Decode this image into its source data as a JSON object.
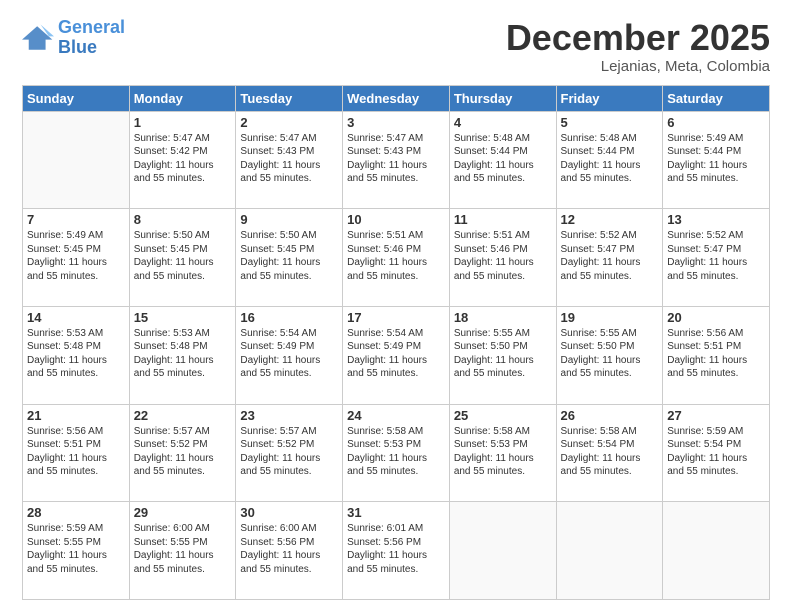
{
  "logo": {
    "line1": "General",
    "line2": "Blue"
  },
  "header": {
    "month": "December 2025",
    "location": "Lejanias, Meta, Colombia"
  },
  "days_of_week": [
    "Sunday",
    "Monday",
    "Tuesday",
    "Wednesday",
    "Thursday",
    "Friday",
    "Saturday"
  ],
  "weeks": [
    [
      {
        "day": "",
        "info": ""
      },
      {
        "day": "1",
        "info": "Sunrise: 5:47 AM\nSunset: 5:42 PM\nDaylight: 11 hours\nand 55 minutes."
      },
      {
        "day": "2",
        "info": "Sunrise: 5:47 AM\nSunset: 5:43 PM\nDaylight: 11 hours\nand 55 minutes."
      },
      {
        "day": "3",
        "info": "Sunrise: 5:47 AM\nSunset: 5:43 PM\nDaylight: 11 hours\nand 55 minutes."
      },
      {
        "day": "4",
        "info": "Sunrise: 5:48 AM\nSunset: 5:44 PM\nDaylight: 11 hours\nand 55 minutes."
      },
      {
        "day": "5",
        "info": "Sunrise: 5:48 AM\nSunset: 5:44 PM\nDaylight: 11 hours\nand 55 minutes."
      },
      {
        "day": "6",
        "info": "Sunrise: 5:49 AM\nSunset: 5:44 PM\nDaylight: 11 hours\nand 55 minutes."
      }
    ],
    [
      {
        "day": "7",
        "info": "Sunrise: 5:49 AM\nSunset: 5:45 PM\nDaylight: 11 hours\nand 55 minutes."
      },
      {
        "day": "8",
        "info": "Sunrise: 5:50 AM\nSunset: 5:45 PM\nDaylight: 11 hours\nand 55 minutes."
      },
      {
        "day": "9",
        "info": "Sunrise: 5:50 AM\nSunset: 5:45 PM\nDaylight: 11 hours\nand 55 minutes."
      },
      {
        "day": "10",
        "info": "Sunrise: 5:51 AM\nSunset: 5:46 PM\nDaylight: 11 hours\nand 55 minutes."
      },
      {
        "day": "11",
        "info": "Sunrise: 5:51 AM\nSunset: 5:46 PM\nDaylight: 11 hours\nand 55 minutes."
      },
      {
        "day": "12",
        "info": "Sunrise: 5:52 AM\nSunset: 5:47 PM\nDaylight: 11 hours\nand 55 minutes."
      },
      {
        "day": "13",
        "info": "Sunrise: 5:52 AM\nSunset: 5:47 PM\nDaylight: 11 hours\nand 55 minutes."
      }
    ],
    [
      {
        "day": "14",
        "info": "Sunrise: 5:53 AM\nSunset: 5:48 PM\nDaylight: 11 hours\nand 55 minutes."
      },
      {
        "day": "15",
        "info": "Sunrise: 5:53 AM\nSunset: 5:48 PM\nDaylight: 11 hours\nand 55 minutes."
      },
      {
        "day": "16",
        "info": "Sunrise: 5:54 AM\nSunset: 5:49 PM\nDaylight: 11 hours\nand 55 minutes."
      },
      {
        "day": "17",
        "info": "Sunrise: 5:54 AM\nSunset: 5:49 PM\nDaylight: 11 hours\nand 55 minutes."
      },
      {
        "day": "18",
        "info": "Sunrise: 5:55 AM\nSunset: 5:50 PM\nDaylight: 11 hours\nand 55 minutes."
      },
      {
        "day": "19",
        "info": "Sunrise: 5:55 AM\nSunset: 5:50 PM\nDaylight: 11 hours\nand 55 minutes."
      },
      {
        "day": "20",
        "info": "Sunrise: 5:56 AM\nSunset: 5:51 PM\nDaylight: 11 hours\nand 55 minutes."
      }
    ],
    [
      {
        "day": "21",
        "info": "Sunrise: 5:56 AM\nSunset: 5:51 PM\nDaylight: 11 hours\nand 55 minutes."
      },
      {
        "day": "22",
        "info": "Sunrise: 5:57 AM\nSunset: 5:52 PM\nDaylight: 11 hours\nand 55 minutes."
      },
      {
        "day": "23",
        "info": "Sunrise: 5:57 AM\nSunset: 5:52 PM\nDaylight: 11 hours\nand 55 minutes."
      },
      {
        "day": "24",
        "info": "Sunrise: 5:58 AM\nSunset: 5:53 PM\nDaylight: 11 hours\nand 55 minutes."
      },
      {
        "day": "25",
        "info": "Sunrise: 5:58 AM\nSunset: 5:53 PM\nDaylight: 11 hours\nand 55 minutes."
      },
      {
        "day": "26",
        "info": "Sunrise: 5:58 AM\nSunset: 5:54 PM\nDaylight: 11 hours\nand 55 minutes."
      },
      {
        "day": "27",
        "info": "Sunrise: 5:59 AM\nSunset: 5:54 PM\nDaylight: 11 hours\nand 55 minutes."
      }
    ],
    [
      {
        "day": "28",
        "info": "Sunrise: 5:59 AM\nSunset: 5:55 PM\nDaylight: 11 hours\nand 55 minutes."
      },
      {
        "day": "29",
        "info": "Sunrise: 6:00 AM\nSunset: 5:55 PM\nDaylight: 11 hours\nand 55 minutes."
      },
      {
        "day": "30",
        "info": "Sunrise: 6:00 AM\nSunset: 5:56 PM\nDaylight: 11 hours\nand 55 minutes."
      },
      {
        "day": "31",
        "info": "Sunrise: 6:01 AM\nSunset: 5:56 PM\nDaylight: 11 hours\nand 55 minutes."
      },
      {
        "day": "",
        "info": ""
      },
      {
        "day": "",
        "info": ""
      },
      {
        "day": "",
        "info": ""
      }
    ]
  ]
}
